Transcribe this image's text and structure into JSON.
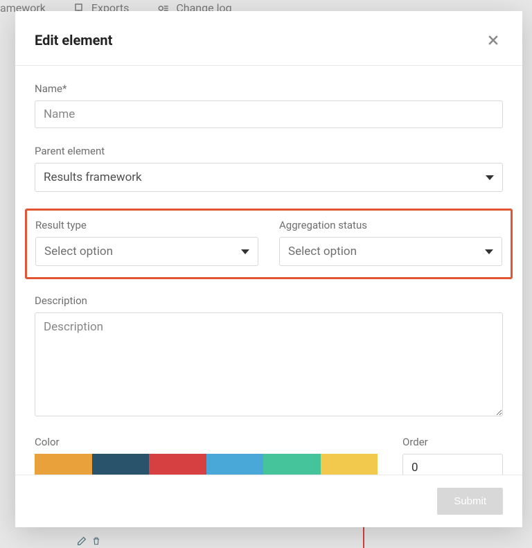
{
  "background": {
    "tabs": [
      "amework",
      "Exports",
      "Change log"
    ]
  },
  "modal": {
    "title": "Edit element",
    "fields": {
      "name": {
        "label": "Name*",
        "placeholder": "Name",
        "value": ""
      },
      "parent": {
        "label": "Parent element",
        "value": "Results framework"
      },
      "result_type": {
        "label": "Result type",
        "placeholder": "Select option"
      },
      "aggregation": {
        "label": "Aggregation status",
        "placeholder": "Select option"
      },
      "description": {
        "label": "Description",
        "placeholder": "Description",
        "value": ""
      },
      "color": {
        "label": "Color"
      },
      "order": {
        "label": "Order",
        "value": "0"
      }
    },
    "palette": [
      "#e9a13b",
      "#28536b",
      "#d64040",
      "#4aa8d8",
      "#45c49c",
      "#f2c94c"
    ],
    "submit_label": "Submit"
  }
}
